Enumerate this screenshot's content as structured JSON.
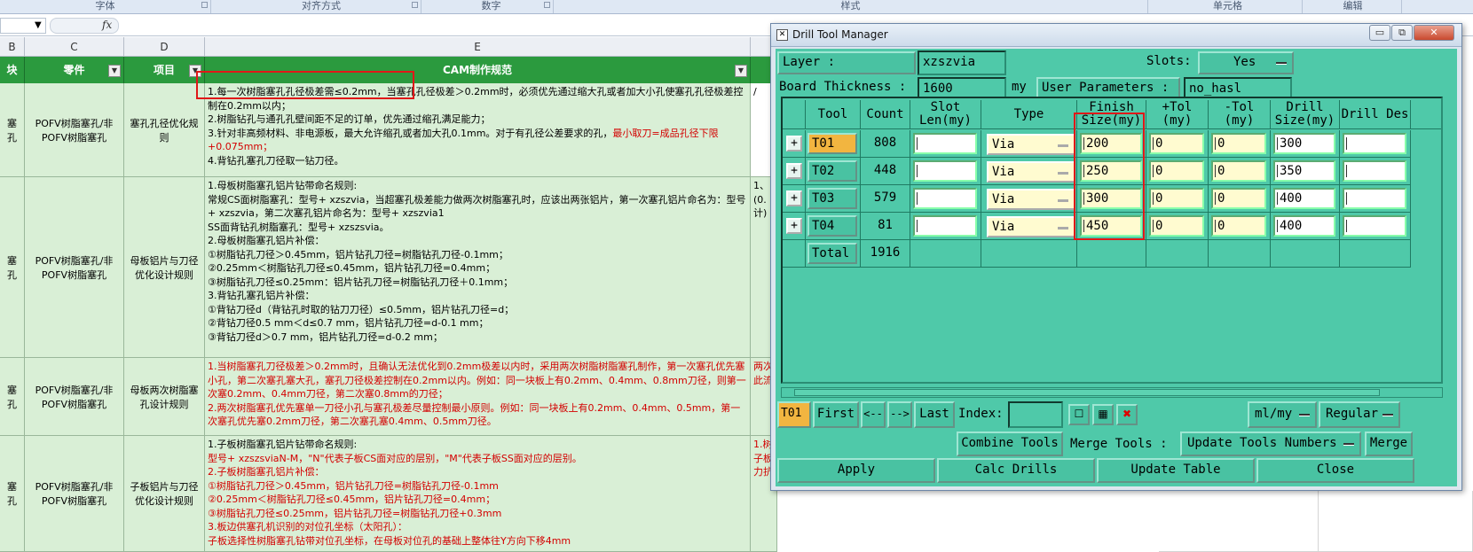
{
  "ribbon": {
    "groups": [
      "字体",
      "对齐方式",
      "数字",
      "样式",
      "单元格",
      "编辑"
    ]
  },
  "formula_bar": {
    "fx": "fx"
  },
  "sheet": {
    "col_headers": [
      "B",
      "C",
      "D",
      "E"
    ],
    "headers": [
      "块",
      "零件",
      "项目",
      "CAM制作规范"
    ],
    "rows": [
      {
        "b": "塞孔",
        "c": "POFV树脂塞孔/非POFV树脂塞孔",
        "d": "塞孔孔径优化规则",
        "lines": [
          {
            "t": "1.每一次树脂塞孔孔径极差需≤0.2mm，当塞孔孔径极差＞0.2mm时，必须优先通过缩大孔或者加大小孔使塞孔孔径极差控制在0.2mm以内；",
            "red": false
          },
          {
            "t": "2.树脂钻孔与通孔孔壁间距不足的订单，优先通过缩孔满足能力；",
            "red": false
          },
          {
            "t": "3.针对非高频材料、非电源板，最大允许缩孔或者加大孔0.1mm。对于有孔径公差要求的孔，",
            "red": false,
            "tail": "最小取刀=成品孔径下限+0.075mm；"
          },
          {
            "t": "4.背钻孔塞孔刀径取一钻刀径。",
            "red": false
          }
        ],
        "f": "/"
      },
      {
        "b": "塞孔",
        "c": "POFV树脂塞孔/非POFV树脂塞孔",
        "d": "母板铝片与刀径优化设计规则",
        "lines": [
          {
            "t": "1.母板树脂塞孔铝片钻带命名规则:",
            "red": false
          },
          {
            "t": "常规CS面树脂塞孔：型号+ xzszvia，当超塞孔极差能力做两次树脂塞孔时，应该出两张铝片，第一次塞孔铝片命名为：型号+ xzszvia，第二次塞孔铝片命名为：型号+ xzszvia1",
            "red": false
          },
          {
            "t": "SS面背钻孔树脂塞孔：型号+ xzszsvia。",
            "red": false
          },
          {
            "t": "2.母板树脂塞孔铝片补偿：",
            "red": false
          },
          {
            "t": "①树脂钻孔刀径＞0.45mm，铝片钻孔刀径=树脂钻孔刀径-0.1mm；",
            "red": false
          },
          {
            "t": "②0.25mm＜树脂钻孔刀径≤0.45mm，铝片钻孔刀径=0.4mm；",
            "red": false
          },
          {
            "t": "③树脂钻孔刀径≤0.25mm：铝片钻孔刀径=树脂钻孔刀径＋0.1mm；",
            "red": false
          },
          {
            "t": "3.背钻孔塞孔铝片补偿：",
            "red": false
          },
          {
            "t": "①背钻刀径d（背钻孔时取的钻刀刀径）≤0.5mm，铝片钻孔刀径=d；",
            "red": false
          },
          {
            "t": "②背钻刀径0.5 mm＜d≤0.7 mm，铝片钻孔刀径=d-0.1 mm；",
            "red": false
          },
          {
            "t": "③背钻刀径d＞0.7 mm，铝片钻孔刀径=d-0.2 mm；",
            "red": false
          }
        ],
        "f": "1、\n(0.\n计)"
      },
      {
        "b": "塞孔",
        "c": "POFV树脂塞孔/非POFV树脂塞孔",
        "d": "母板两次树脂塞孔设计规则",
        "lines": [
          {
            "t": "1.当树脂塞孔刀径极差＞0.2mm时，且确认无法优化到0.2mm极差以内时，采用两次树脂树脂塞孔制作，第一次塞孔优先塞小孔，第二次塞孔塞大孔，塞孔刀径极差控制在0.2mm以内。例如：同一块板上有0.2mm、0.4mm、0.8mm刀径，则第一次塞0.2mm、0.4mm刀径，第二次塞0.8mm的刀径；",
            "red": true
          },
          {
            "t": "2.两次树脂塞孔优先塞单一刀径小孔与塞孔极差尽量控制最小原则。例如：同一块板上有0.2mm、0.4mm、0.5mm，第一次塞孔优先塞0.2mm刀径，第二次塞孔塞0.4mm、0.5mm刀径。",
            "red": true
          }
        ],
        "f": "两次\n此流"
      },
      {
        "b": "塞孔",
        "c": "POFV树脂塞孔/非POFV树脂塞孔",
        "d": "子板铝片与刀径优化设计规则",
        "lines": [
          {
            "t": "1.子板树脂塞孔铝片钻带命名规则:",
            "red": false
          },
          {
            "t": "型号+ xzszsviaN-M，\"N\"代表子板CS面对应的层别，\"M\"代表子板SS面对应的层别。",
            "red": true
          },
          {
            "t": "2.子板树脂塞孔铝片补偿：",
            "red": true
          },
          {
            "t": "①树脂钻孔刀径＞0.45mm，铝片钻孔刀径=树脂钻孔刀径-0.1mm",
            "red": true
          },
          {
            "t": "②0.25mm＜树脂钻孔刀径≤0.45mm，铝片钻孔刀径=0.4mm；",
            "red": true
          },
          {
            "t": "③树脂钻孔刀径≤0.25mm，铝片钻孔刀径=树脂钻孔刀径+0.3mm",
            "red": true
          },
          {
            "t": "3.板边供塞孔机识别的对位孔坐标（太阳孔）：",
            "red": true
          },
          {
            "t": "子板选择性树脂塞孔钻带对位孔坐标，在母板对位孔的基础上整体往Y方向下移4mm",
            "red": true
          }
        ],
        "f": "1.树\n子板\n力抗"
      }
    ]
  },
  "dialog": {
    "title": "Drill Tool Manager",
    "layer_label": "Layer          :",
    "layer_value": "xzszvia",
    "slots_label": "Slots:",
    "slots_value": "Yes",
    "board_thickness_label": "Board Thickness :",
    "board_thickness_value": "1600",
    "board_thickness_unit": "my",
    "user_params_label": "User Parameters :",
    "user_params_value": "no_hasl",
    "columns": [
      "Tool",
      "Count",
      "Slot Len(my)",
      "Type",
      "Finish Size(my)",
      "+Tol (my)",
      "-Tol (my)",
      "Drill Size(my)",
      "Drill Des"
    ],
    "tools": [
      {
        "tool": "T01",
        "count": "808",
        "type": "Via",
        "finish": "200",
        "ptol": "0",
        "ntol": "0",
        "drill": "300"
      },
      {
        "tool": "T02",
        "count": "448",
        "type": "Via",
        "finish": "250",
        "ptol": "0",
        "ntol": "0",
        "drill": "350"
      },
      {
        "tool": "T03",
        "count": "579",
        "type": "Via",
        "finish": "300",
        "ptol": "0",
        "ntol": "0",
        "drill": "400"
      },
      {
        "tool": "T04",
        "count": "81",
        "type": "Via",
        "finish": "450",
        "ptol": "0",
        "ntol": "0",
        "drill": "400"
      }
    ],
    "total_label": "Total",
    "total_count": "1916",
    "current_tool": "T01",
    "nav": {
      "first": "First",
      "prev": "<--",
      "next": "-->",
      "last": "Last",
      "index_label": "Index:"
    },
    "units_value": "ml/my",
    "mode_value": "Regular",
    "combine_tools": "Combine Tools",
    "merge_tools_label": "Merge Tools :",
    "merge_tools_value": "Update Tools Numbers",
    "merge": "Merge",
    "apply": "Apply",
    "calc_drills": "Calc Drills",
    "update_table": "Update Table",
    "close": "Close"
  }
}
